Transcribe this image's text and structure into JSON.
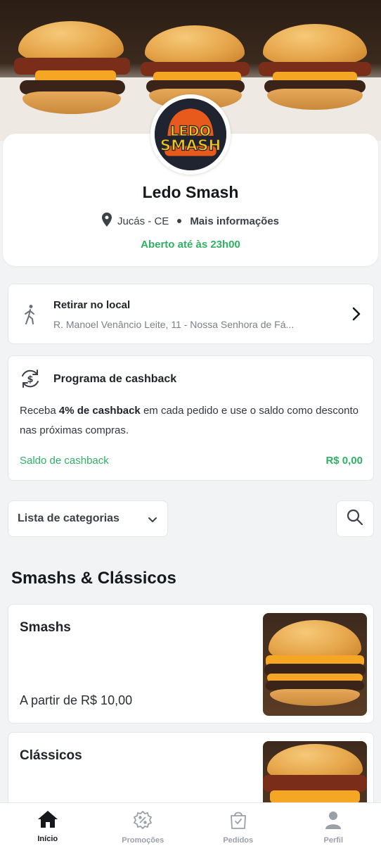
{
  "store": {
    "name": "Ledo Smash",
    "logo_text_top": "LEDO",
    "logo_text_bottom": "SMASH",
    "city": "Jucás - CE",
    "more_info": "Mais informações",
    "open_status": "Aberto até às 23h00"
  },
  "pickup": {
    "title": "Retirar no local",
    "address": "R. Manoel Venâncio Leite, 11 - Nossa Senhora de Fá..."
  },
  "cashback": {
    "title": "Programa de cashback",
    "desc_pre": "Receba ",
    "desc_bold": "4% de cashback",
    "desc_post": " em cada pedido e use o saldo como desconto nas próximas compras.",
    "balance_label": "Saldo de cashback",
    "balance_value": "R$ 0,00"
  },
  "categories": {
    "select_label": "Lista de categorias"
  },
  "section": {
    "title": "Smashs & Clássicos",
    "items": [
      {
        "name": "Smashs",
        "price": "A partir de R$ 10,00"
      },
      {
        "name": "Clássicos",
        "price": ""
      }
    ]
  },
  "tabs": [
    {
      "label": "Início",
      "icon": "home-icon"
    },
    {
      "label": "Promoções",
      "icon": "percent-badge-icon"
    },
    {
      "label": "Pedidos",
      "icon": "shopping-bag-icon"
    },
    {
      "label": "Perfil",
      "icon": "user-icon"
    }
  ],
  "colors": {
    "accent_green": "#2fb163",
    "logo_bg": "#1f2430",
    "logo_orange": "#e85a1c",
    "logo_yellow": "#f5c518"
  }
}
